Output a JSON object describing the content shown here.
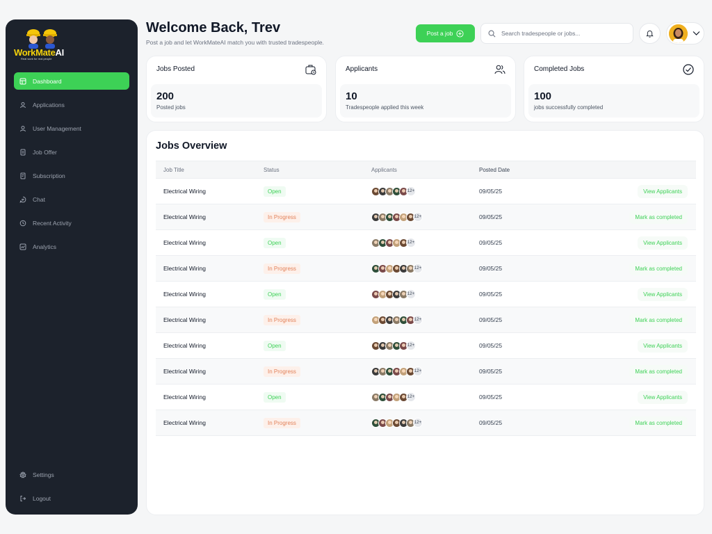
{
  "sidebar": {
    "logo": {
      "word_work": "Work",
      "word_mate": "Mate",
      "word_ai": "AI",
      "tagline": "Real work for real people"
    },
    "items": [
      {
        "label": "Dashboard",
        "icon": "dashboard-icon",
        "active": true
      },
      {
        "label": "Applications",
        "icon": "user-icon"
      },
      {
        "label": "User Management",
        "icon": "user-icon"
      },
      {
        "label": "Job Offer",
        "icon": "document-icon"
      },
      {
        "label": "Subscription",
        "icon": "receipt-icon"
      },
      {
        "label": "Chat",
        "icon": "chat-icon"
      },
      {
        "label": "Recent Activity",
        "icon": "clock-icon"
      },
      {
        "label": "Analytics",
        "icon": "analytics-icon"
      }
    ],
    "bottom": [
      {
        "label": "Settings",
        "icon": "gear-icon"
      },
      {
        "label": "Logout",
        "icon": "logout-icon"
      }
    ]
  },
  "header": {
    "title": "Welcome Back, Trev",
    "subtitle": "Post a job and let WorkMateAI match you with trusted tradespeople.",
    "post_button": "Post a job",
    "search_placeholder": "Search tradespeople or jobs..."
  },
  "stats": [
    {
      "title": "Jobs Posted",
      "value": "200",
      "label": "Posted jobs",
      "icon": "briefcase-icon"
    },
    {
      "title": "Applicants",
      "value": "10",
      "label": "Tradespeople applied this week",
      "icon": "users-icon"
    },
    {
      "title": "Completed Jobs",
      "value": "100",
      "label": "jobs successfully completed",
      "icon": "check-circle-icon"
    }
  ],
  "overview": {
    "title": "Jobs Overview",
    "columns": [
      "Job Title",
      "Status",
      "Applicants",
      "Posted Date"
    ],
    "rows": [
      {
        "title": "Electrical Wiring",
        "status": "Open",
        "more": "12+",
        "date": "09/05/25",
        "action": "View Applicants"
      },
      {
        "title": "Electrical Wiring",
        "status": "In Progress",
        "more": "12+",
        "date": "09/05/25",
        "action": "Mark as completed"
      },
      {
        "title": "Electrical Wiring",
        "status": "Open",
        "more": "12+",
        "date": "09/05/25",
        "action": "View Applicants"
      },
      {
        "title": "Electrical Wiring",
        "status": "In Progress",
        "more": "12+",
        "date": "09/05/25",
        "action": "Mark as completed"
      },
      {
        "title": "Electrical Wiring",
        "status": "Open",
        "more": "12+",
        "date": "09/05/25",
        "action": "View Applicants"
      },
      {
        "title": "Electrical Wiring",
        "status": "In Progress",
        "more": "12+",
        "date": "09/05/25",
        "action": "Mark as completed"
      },
      {
        "title": "Electrical Wiring",
        "status": "Open",
        "more": "12+",
        "date": "09/05/25",
        "action": "View Applicants"
      },
      {
        "title": "Electrical Wiring",
        "status": "In Progress",
        "more": "12+",
        "date": "09/05/25",
        "action": "Mark as completed"
      },
      {
        "title": "Electrical Wiring",
        "status": "Open",
        "more": "12+",
        "date": "09/05/25",
        "action": "View Applicants"
      },
      {
        "title": "Electrical Wiring",
        "status": "In Progress",
        "more": "12+",
        "date": "09/05/25",
        "action": "Mark as completed"
      }
    ]
  },
  "colors": {
    "accent": "#3dd156",
    "sidebar_bg": "#1c222c",
    "progress": "#e2825a"
  }
}
